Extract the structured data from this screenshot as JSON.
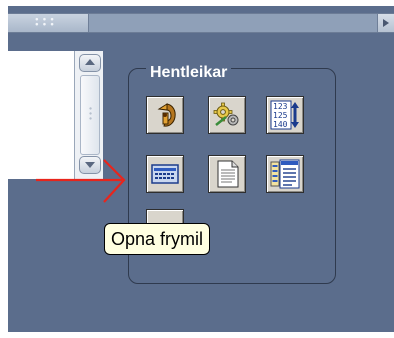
{
  "panel": {
    "title": "Hentleikar"
  },
  "tooltip": {
    "text": "Opna frymil"
  },
  "toolbar": {
    "icons": [
      "run-macro-icon",
      "settings-gear-icon",
      "sort-numbers-icon",
      "form-icon",
      "document-icon",
      "list-view-icon"
    ]
  },
  "colors": {
    "workspace": "#5b6d8c",
    "button_face": "#d9d5cc",
    "tooltip_bg": "#ffffe1",
    "arrow": "#e8251c"
  }
}
